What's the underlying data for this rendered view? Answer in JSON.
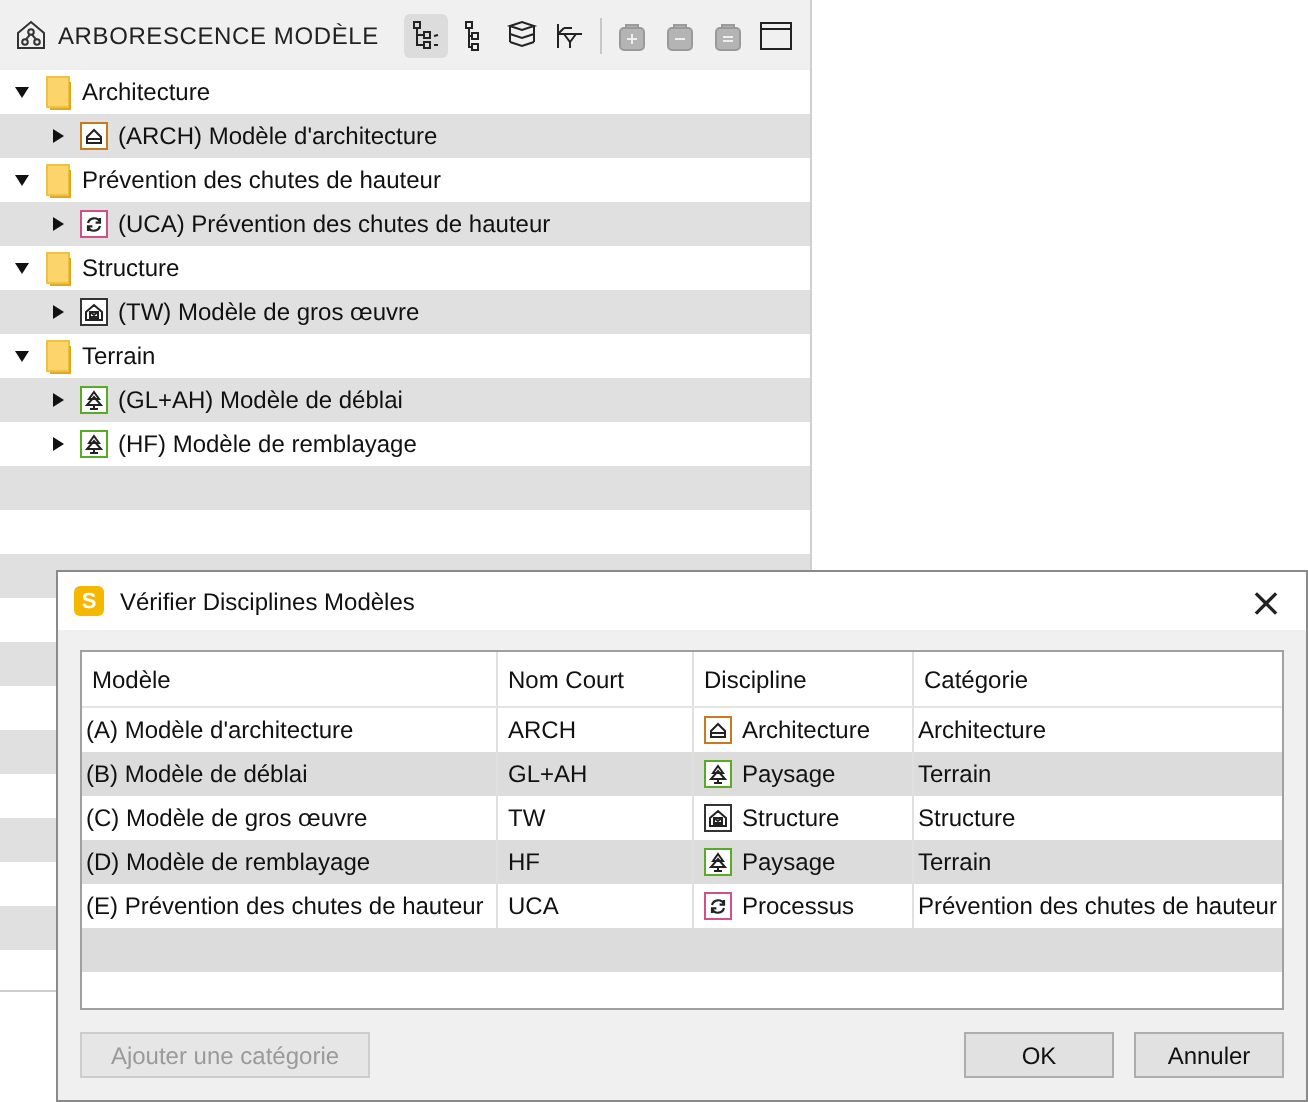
{
  "panel": {
    "title": "ARBORESCENCE MODÈLE",
    "toolbar": [
      {
        "kind": "tree-view",
        "selected": true,
        "disabled": false
      },
      {
        "kind": "list-view",
        "selected": false,
        "disabled": false
      },
      {
        "kind": "layers-view",
        "selected": false,
        "disabled": false
      },
      {
        "kind": "filter-view",
        "selected": false,
        "disabled": false
      },
      {
        "kind": "add",
        "selected": false,
        "disabled": true
      },
      {
        "kind": "remove",
        "selected": false,
        "disabled": true
      },
      {
        "kind": "edit",
        "selected": false,
        "disabled": true
      },
      {
        "kind": "window",
        "selected": false,
        "disabled": false
      }
    ],
    "tree": [
      {
        "label": "Architecture",
        "expanded": true,
        "children": [
          {
            "label": "(ARCH) Modèle d'architecture",
            "kind": "architecture",
            "expanded": false
          }
        ]
      },
      {
        "label": "Prévention des chutes de hauteur",
        "expanded": true,
        "children": [
          {
            "label": "(UCA) Prévention des chutes de hauteur",
            "kind": "process",
            "expanded": false
          }
        ]
      },
      {
        "label": "Structure",
        "expanded": true,
        "children": [
          {
            "label": "(TW) Modèle de gros œuvre",
            "kind": "structure",
            "expanded": false
          }
        ]
      },
      {
        "label": "Terrain",
        "expanded": true,
        "children": [
          {
            "label": "(GL+AH) Modèle de déblai",
            "kind": "landscape",
            "expanded": false
          },
          {
            "label": "(HF) Modèle de remblayage",
            "kind": "landscape",
            "expanded": false
          }
        ]
      }
    ]
  },
  "dialog": {
    "app_badge": "S",
    "title": "Vérifier Disciplines Modèles",
    "close": "×",
    "columns": [
      "Modèle",
      "Nom Court",
      "Discipline",
      "Catégorie"
    ],
    "rows": [
      {
        "model": "(A) Modèle d'architecture",
        "short_name": "ARCH",
        "discipline": "Architecture",
        "kind": "architecture",
        "category": "Architecture"
      },
      {
        "model": "(B) Modèle de déblai",
        "short_name": "GL+AH",
        "discipline": "Paysage",
        "kind": "landscape",
        "category": "Terrain"
      },
      {
        "model": "(C) Modèle de gros œuvre",
        "short_name": "TW",
        "discipline": "Structure",
        "kind": "structure",
        "category": "Structure"
      },
      {
        "model": "(D) Modèle de remblayage",
        "short_name": "HF",
        "discipline": "Paysage",
        "kind": "landscape",
        "category": "Terrain"
      },
      {
        "model": "(E) Prévention des chutes de hauteur",
        "short_name": "UCA",
        "discipline": "Processus",
        "kind": "process",
        "category": "Prévention des chutes de hauteur"
      }
    ],
    "buttons": [
      {
        "label": "Ajouter une catégorie",
        "kind": "left",
        "disabled": true
      },
      {
        "label": "OK",
        "kind": "right",
        "disabled": false
      },
      {
        "label": "Annuler",
        "kind": "right",
        "disabled": false
      }
    ]
  }
}
